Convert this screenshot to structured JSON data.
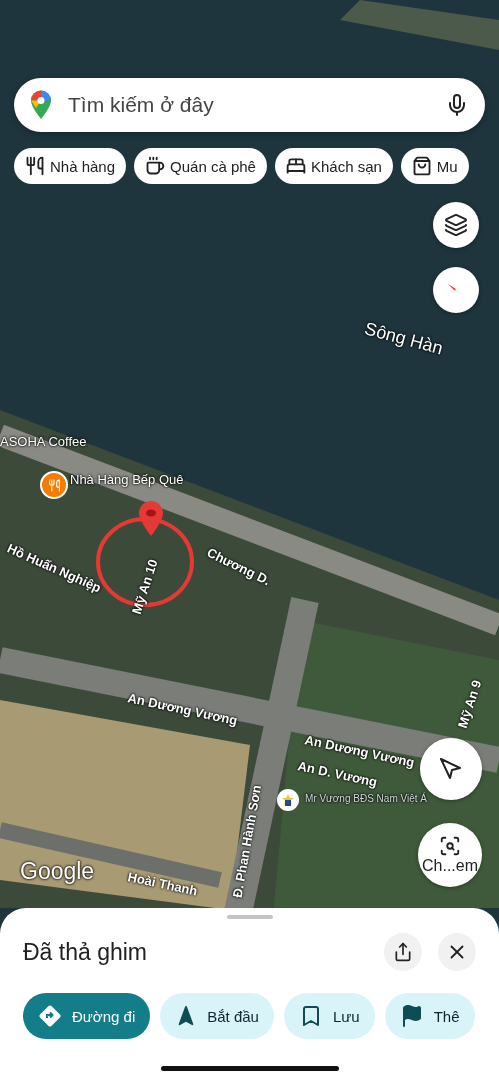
{
  "search": {
    "placeholder": "Tìm kiếm ở đây"
  },
  "categories": [
    {
      "kind": "restaurant",
      "label": "Nhà hàng"
    },
    {
      "kind": "cafe",
      "label": "Quán cà phê"
    },
    {
      "kind": "hotel",
      "label": "Khách sạn"
    },
    {
      "kind": "shopping",
      "label": "Mu"
    }
  ],
  "map": {
    "labels": [
      {
        "kind": "place",
        "text": "Sông Hàn"
      },
      {
        "kind": "poi",
        "text": "ASOHA Coffee"
      },
      {
        "kind": "restaurant",
        "text": "Nhà Hàng Bếp Quê"
      },
      {
        "kind": "street",
        "text": "Hồ Huấn Nghiệp"
      },
      {
        "kind": "street",
        "text": "Mỹ An 10"
      },
      {
        "kind": "street",
        "text": "Chương D."
      },
      {
        "kind": "street",
        "text": "An Dương Vương"
      },
      {
        "kind": "street",
        "text": "An Dương Vương"
      },
      {
        "kind": "street",
        "text": "An D. Vương"
      },
      {
        "kind": "business",
        "text": "Mr Vương BĐS Nam Việt Á"
      },
      {
        "kind": "street",
        "text": "Đ. Phan Hành Sơn"
      },
      {
        "kind": "street",
        "text": "Mỹ An 9"
      },
      {
        "kind": "street",
        "text": "Hoài Thanh"
      },
      {
        "kind": "logo",
        "text": "Google"
      }
    ],
    "camera_label": "Ch...em"
  },
  "sheet": {
    "title": "Đã thả ghim",
    "actions": [
      {
        "kind": "directions",
        "label": "Đường đi",
        "selected": true
      },
      {
        "kind": "start",
        "label": "Bắt đầu",
        "selected": false
      },
      {
        "kind": "save",
        "label": "Lưu",
        "selected": false
      },
      {
        "kind": "flag",
        "label": "Thê",
        "selected": false
      }
    ]
  }
}
